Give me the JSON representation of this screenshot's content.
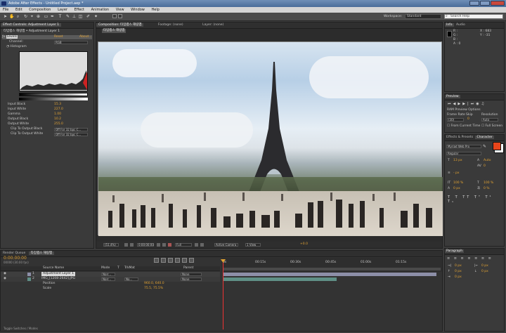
{
  "window": {
    "title": "Adobe After Effects - Untitled Project.aep *"
  },
  "menu": [
    "File",
    "Edit",
    "Composition",
    "Layer",
    "Effect",
    "Animation",
    "View",
    "Window",
    "Help"
  ],
  "toolbar": {
    "workspace_label": "Workspace:",
    "workspace_value": "Standard",
    "search_placeholder": "Search Help"
  },
  "effect_controls": {
    "tab": "Effect Controls: Adjustment Layer 1",
    "path": "타임랩스 해링맵 • Adjustment Layer 1",
    "effect_name": "Levels",
    "reset": "Reset",
    "about": "About...",
    "channel_label": "Channel:",
    "channel_value": "RGB",
    "histogram_label": "Histogram",
    "params": [
      {
        "name": "Input Black",
        "value": "15.3"
      },
      {
        "name": "Input White",
        "value": "227.0"
      },
      {
        "name": "Gamma",
        "value": "1.00"
      },
      {
        "name": "Output Black",
        "value": "10.2"
      },
      {
        "name": "Output White",
        "value": "255.0"
      }
    ],
    "clip_black_label": "Clip To Output Black",
    "clip_black_value": "Off For 32 bpc C...",
    "clip_white_label": "Clip To Output White",
    "clip_white_value": "Off For 32 bpc C..."
  },
  "viewer": {
    "tab_comp": "Composition: 타임랩스 해링맵",
    "tab_footage": "Footage: (none)",
    "tab_layer": "Layer: (none)",
    "comp_name": "타임랩스 해링맵",
    "zoom": "(51.4%)",
    "timecode": "0:00:00:00",
    "resolution": "Full",
    "camera": "Active Camera",
    "views": "1 View",
    "exposure": "+0.0"
  },
  "info": {
    "tab_info": "Info",
    "tab_audio": "Audio",
    "r": "R :",
    "g": "G :",
    "b": "B :",
    "a": "A : 0",
    "x": "X : 683",
    "y": "Y : -31"
  },
  "preview": {
    "tab": "Preview",
    "ram_options": "RAM Preview Options",
    "frame_rate_label": "Frame Rate",
    "skip_label": "Skip",
    "resolution_label": "Resolution",
    "frame_rate": "(30)",
    "skip": "0",
    "resolution": "Auto",
    "from_current": "From Current Time",
    "full_screen": "Full Screen"
  },
  "character": {
    "tab_effects": "Effects & Presets",
    "tab_character": "Character",
    "font": "Myriad Web Pro",
    "style": "Regular",
    "size": "13 px",
    "leading": "Auto",
    "tracking": "0",
    "stroke": "- px",
    "scale_v": "100 %",
    "scale_h": "100 %",
    "baseline": "0 px",
    "tsume": "0 %",
    "fill_color": "#e8451b"
  },
  "paragraph": {
    "tab": "Paragraph",
    "indent_left": "0 px",
    "indent_right": "0 px",
    "space_before": "0 px",
    "space_after": "0 px",
    "indent_first": "0 px"
  },
  "timeline": {
    "tab_render": "Render Queue",
    "tab_comp": "타임랩스 해링맵",
    "timecode": "0:00:00:00",
    "timecode_sub": "00000 (30.00 fps)",
    "col_source": "Source Name",
    "col_mode": "Mode",
    "col_t": "T",
    "col_trkmat": "TrkMat",
    "col_parent": "Parent",
    "layers": [
      {
        "index": "1",
        "name": "Adjustment Layer 1",
        "mode": "Norr...",
        "trkmat": "",
        "parent": "None"
      },
      {
        "index": "2",
        "name": "IMG_[1208-2642].JPG",
        "mode": "Norr...",
        "trkmat": "No...",
        "parent": "None"
      }
    ],
    "prop_position": "Position",
    "prop_position_value": "960.0, 640.0",
    "prop_scale": "Scale",
    "prop_scale_value": "75.5, 75.5%",
    "ruler": [
      "0s",
      "00:15s",
      "00:30s",
      "00:45s",
      "01:00s",
      "01:15s"
    ],
    "toggle_label": "Toggle Switches / Modes"
  },
  "colors": {
    "accent": "#e1a233",
    "fill": "#e8451b",
    "layer_bar1": "#8d8fa8",
    "layer_bar2": "#5f8f86"
  }
}
